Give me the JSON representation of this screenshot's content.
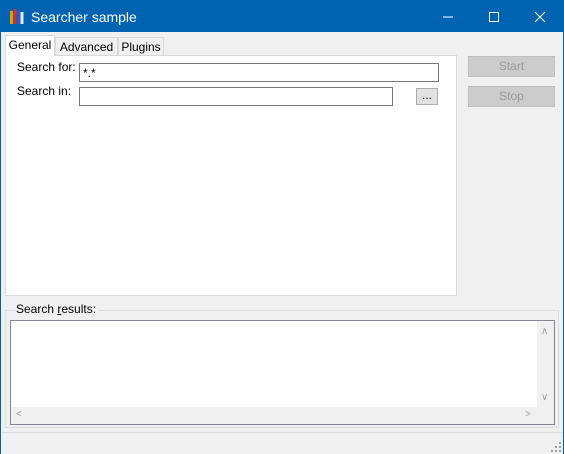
{
  "window": {
    "title": "Searcher sample",
    "accent_color": "#0063b1",
    "icon": "books-app-icon"
  },
  "tabs": [
    {
      "label": "General",
      "active": true
    },
    {
      "label": "Advanced",
      "active": false
    },
    {
      "label": "Plugins",
      "active": false
    }
  ],
  "general": {
    "search_for_label": "Search for:",
    "search_for_value": "*.*",
    "search_in_label": "Search in:",
    "search_in_value": "",
    "browse_label": "..."
  },
  "actions": {
    "start_label": "Start",
    "stop_label": "Stop"
  },
  "results": {
    "label_prefix": "Search ",
    "label_mnemonic": "r",
    "label_suffix": "esults:"
  }
}
